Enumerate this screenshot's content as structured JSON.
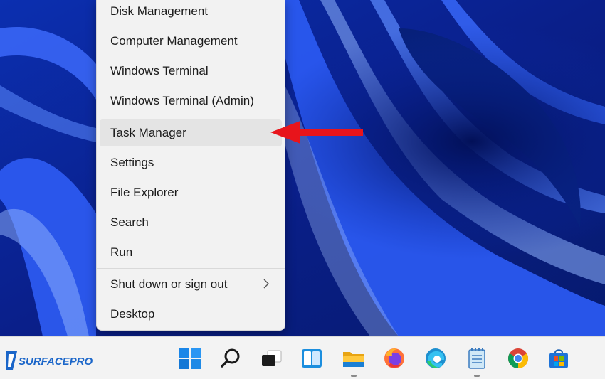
{
  "context_menu": {
    "items": [
      {
        "label": "Disk Management"
      },
      {
        "label": "Computer Management"
      },
      {
        "label": "Windows Terminal"
      },
      {
        "label": "Windows Terminal (Admin)"
      },
      {
        "label": "Task Manager",
        "highlighted": true
      },
      {
        "label": "Settings"
      },
      {
        "label": "File Explorer"
      },
      {
        "label": "Search"
      },
      {
        "label": "Run"
      },
      {
        "label": "Shut down or sign out",
        "has_submenu": true
      },
      {
        "label": "Desktop"
      }
    ]
  },
  "taskbar": {
    "icons": [
      {
        "name": "start",
        "icon": "windows-logo-icon"
      },
      {
        "name": "search",
        "icon": "search-icon"
      },
      {
        "name": "task-view",
        "icon": "task-view-icon"
      },
      {
        "name": "widgets",
        "icon": "widgets-icon"
      },
      {
        "name": "file-explorer",
        "icon": "folder-icon",
        "running": true
      },
      {
        "name": "firefox",
        "icon": "firefox-icon"
      },
      {
        "name": "edge",
        "icon": "edge-icon"
      },
      {
        "name": "notepad",
        "icon": "notepad-icon",
        "running": true
      },
      {
        "name": "chrome",
        "icon": "chrome-icon"
      },
      {
        "name": "store",
        "icon": "store-icon"
      }
    ]
  },
  "watermark": {
    "text": "SURFACEPRO"
  },
  "colors": {
    "accent_red": "#e8141b",
    "wallpaper_blue": "#1a48e0",
    "menu_bg": "#f2f2f2",
    "taskbar_bg": "#f3f3f3"
  }
}
